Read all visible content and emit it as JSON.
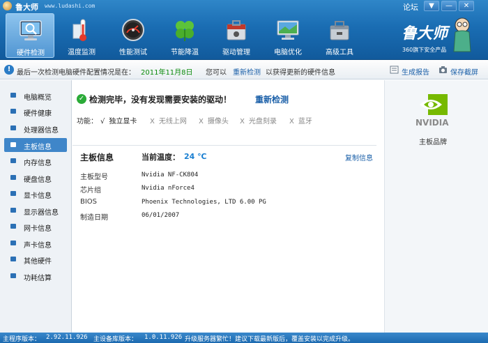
{
  "titlebar": {
    "app_name": "鲁大师",
    "url": "www.ludashi.com",
    "forum": "论坛",
    "menu_btn": "▼",
    "min_btn": "—",
    "close_btn": "✕"
  },
  "nav": {
    "items": [
      {
        "label": "硬件检测",
        "icon": "monitor-magnifier-icon"
      },
      {
        "label": "温度监测",
        "icon": "thermometer-icon"
      },
      {
        "label": "性能测试",
        "icon": "speedometer-icon"
      },
      {
        "label": "节能降温",
        "icon": "clover-icon"
      },
      {
        "label": "驱动管理",
        "icon": "toolbox-icon"
      },
      {
        "label": "电脑优化",
        "icon": "computer-icon"
      },
      {
        "label": "高级工具",
        "icon": "toolbox-pc-icon"
      }
    ],
    "active_index": 0
  },
  "brand": {
    "name": "鲁大师",
    "tagline": "360旗下安全产品"
  },
  "infobar": {
    "prefix": "最后一次检测电脑硬件配置情况是在：",
    "date": "2011年11月8日",
    "mid": "您可以",
    "link": "重新检测",
    "suffix": "以获得更新的硬件信息",
    "report": "生成报告",
    "screenshot": "保存截屏"
  },
  "sidebar": {
    "items": [
      "电脑概览",
      "硬件健康",
      "处理器信息",
      "主板信息",
      "内存信息",
      "硬盘信息",
      "显卡信息",
      "显示器信息",
      "网卡信息",
      "声卡信息",
      "其他硬件",
      "功耗估算"
    ],
    "active_index": 3
  },
  "main": {
    "status_title": "检测完毕，没有发现需要安装的驱动！",
    "status_link": "重新检测",
    "feature_label": "功能：",
    "features": [
      {
        "mark": "√",
        "label": "独立显卡",
        "enabled": true
      },
      {
        "mark": "X",
        "label": "无线上网",
        "enabled": false
      },
      {
        "mark": "X",
        "label": "摄像头",
        "enabled": false
      },
      {
        "mark": "X",
        "label": "光盘刻录",
        "enabled": false
      },
      {
        "mark": "X",
        "label": "蓝牙",
        "enabled": false
      }
    ],
    "section_title": "主板信息",
    "temp_label": "当前温度：",
    "temp_value": "24 ℃",
    "copy_info": "复制信息",
    "rows": [
      {
        "label": "主板型号",
        "value": "Nvidia NF-CK804"
      },
      {
        "label": "芯片组",
        "value": "Nvidia nForce4"
      },
      {
        "label": "BIOS",
        "value": "Phoenix Technologies, LTD 6.00 PG"
      },
      {
        "label": "制造日期",
        "value": "06/01/2007"
      }
    ]
  },
  "right": {
    "logo_text": "NVIDIA",
    "caption": "主板品牌"
  },
  "statusbar": {
    "program_label": "主程序版本：",
    "program_version": "2.92.11.926",
    "db_label": "主设备库版本：",
    "db_version": "1.0.11.926",
    "notice": "升级服务器繁忙！建议下载最新版后，覆盖安装以完成升级。"
  },
  "colors": {
    "header": "#1a6db3",
    "accent": "#3f86c9",
    "link": "#1a5fa8",
    "ok_green": "#2bab38",
    "date_green": "#0a8a0a",
    "temp_blue": "#1a7fd1",
    "nvidia_green": "#76b900"
  }
}
